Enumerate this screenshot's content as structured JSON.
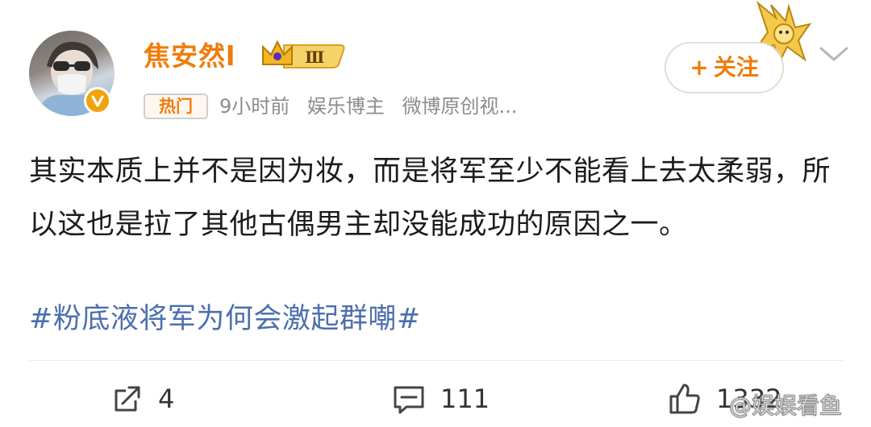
{
  "user": {
    "name": "焦安然l",
    "badge_level": "Ⅲ",
    "hot_tag": "热门",
    "time": "9小时前",
    "role": "娱乐博主",
    "meta_extra": "微博原创视..."
  },
  "follow": {
    "label": "关注",
    "plus": "+"
  },
  "post": {
    "text": "其实本质上并不是因为妆，而是将军至少不能看上去太柔弱，所以这也是拉了其他古偶男主却没能成功的原因之一。",
    "hashtag": "#粉底液将军为何会激起群嘲#"
  },
  "actions": {
    "repost_count": "4",
    "comment_count": "111",
    "like_count": "1332"
  },
  "watermark": "@娱娱看鱼",
  "icons": {
    "verified": "verified-v-icon",
    "crown": "crown-icon",
    "repost": "repost-icon",
    "comment": "comment-icon",
    "like": "thumbs-up-icon",
    "chevron": "chevron-down-icon"
  },
  "colors": {
    "name": "#f07c0c",
    "hashtag": "#4c6fae",
    "meta": "#8c8c8c",
    "verified": "#f2a20c"
  }
}
